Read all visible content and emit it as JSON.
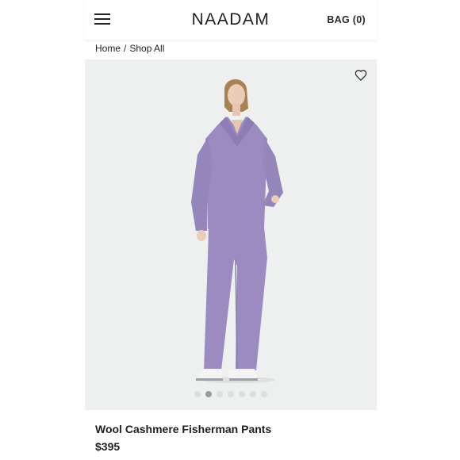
{
  "header": {
    "brand": "NAADAM",
    "bag_label": "BAG (0)"
  },
  "breadcrumb": {
    "home": "Home",
    "separator": "/",
    "current": "Shop All"
  },
  "product": {
    "name": "Wool Cashmere Fisherman Pants",
    "price": "$395",
    "gallery": {
      "total_images": 7,
      "active_index": 1
    }
  },
  "icons": {
    "menu": "hamburger-menu-icon",
    "wishlist": "heart-icon"
  },
  "colors": {
    "product_color": "#9b8bc0",
    "background": "#eef0ef"
  }
}
